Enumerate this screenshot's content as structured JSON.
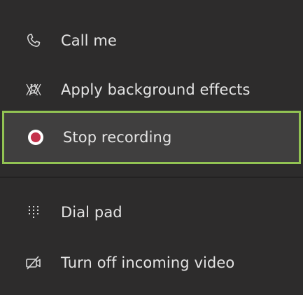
{
  "menu": {
    "items": [
      {
        "id": "call-me",
        "label": "Call me",
        "icon": "phone-icon"
      },
      {
        "id": "background-effects",
        "label": "Apply background effects",
        "icon": "background-effects-icon"
      },
      {
        "id": "stop-recording",
        "label": "Stop recording",
        "icon": "record-icon"
      },
      {
        "id": "dial-pad",
        "label": "Dial pad",
        "icon": "dial-pad-icon"
      },
      {
        "id": "incoming-video",
        "label": "Turn off incoming video",
        "icon": "video-off-icon"
      }
    ]
  },
  "colors": {
    "background": "#2d2c2c",
    "highlight_background": "#403f3f",
    "highlight_border": "#92c353",
    "record_dot": "#c4314b",
    "text": "#e4e4e4"
  }
}
